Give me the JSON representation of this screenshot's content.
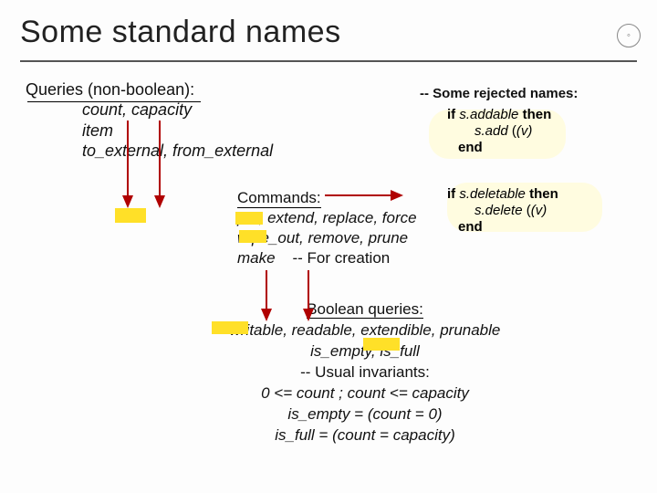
{
  "slide": {
    "title": "Some standard names"
  },
  "queries": {
    "heading": "Queries (non-boolean):",
    "line1": "count, capacity",
    "line2": "item",
    "line3": "to_external, from_external"
  },
  "rejected": {
    "heading": "-- Some rejected names:",
    "snippet_add": {
      "l1_kw_if": "if",
      "l1_expr": "s.addable",
      "l1_kw_then": "then",
      "l2_call": "s.add",
      "l2_arg": "(v)",
      "l3_kw_end": "end"
    },
    "snippet_del": {
      "l1_kw_if": "if",
      "l1_expr": "s.deletable",
      "l1_kw_then": "then",
      "l2_call": "s.delete",
      "l2_arg": "(v)",
      "l3_kw_end": "end"
    }
  },
  "commands": {
    "heading": "Commands:",
    "line1": "put, extend, replace,  force",
    "line2": "wipe_out, remove, prune",
    "line3_a": "make",
    "line3_b": "-- For creation"
  },
  "boolq": {
    "heading": "Boolean queries:",
    "line1": "writable, readable, extendible, prunable",
    "line2": "is_empty, is_full",
    "inv_heading": "-- Usual invariants:",
    "inv1": "0 <= count ; count <= capacity",
    "inv2": "is_empty = (count = 0)",
    "inv3": "is_full = (count = capacity)"
  },
  "logo": {
    "glyph": "◦"
  }
}
